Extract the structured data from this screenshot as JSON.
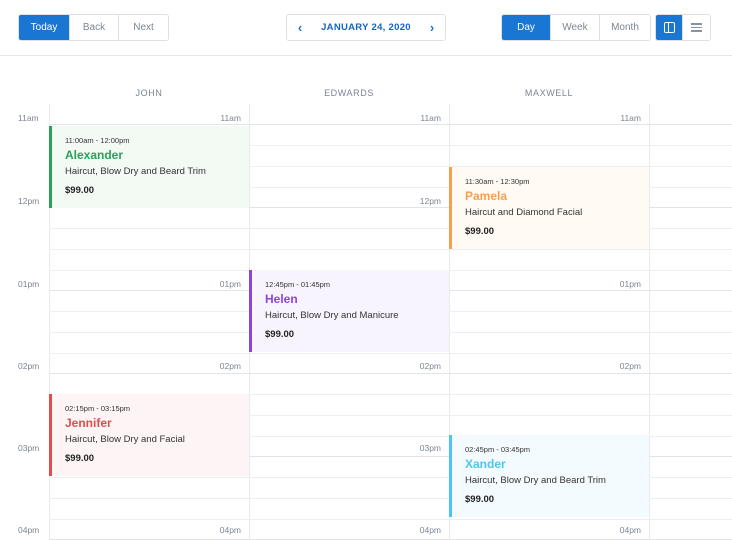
{
  "toolbar": {
    "today": "Today",
    "back": "Back",
    "next": "Next",
    "prev_arrow": "‹",
    "next_arrow": "›",
    "date": "JANUARY 24, 2020",
    "views": [
      "Day",
      "Week",
      "Month"
    ],
    "active_view": "Day",
    "accent_color": "#1976d2"
  },
  "resources": [
    "JOHN",
    "EDWARDS",
    "MAXWELL"
  ],
  "time_labels": [
    "11am",
    "12pm",
    "01pm",
    "02pm",
    "03pm",
    "04pm"
  ],
  "events": [
    {
      "time": "11:00am - 12:00pm",
      "name": "Alexander",
      "service": "Haircut, Blow Dry and Beard Trim",
      "price": "$99.00",
      "color": "#2aa15a"
    },
    {
      "time": "11:30am - 12:30pm",
      "name": "Pamela",
      "service": "Haircut and Diamond Facial",
      "price": "$99.00",
      "color": "#f3a053"
    },
    {
      "time": "12:45pm - 01:45pm",
      "name": "Helen",
      "service": "Haircut, Blow Dry and Manicure",
      "price": "$99.00",
      "color": "#8e44d8"
    },
    {
      "time": "02:15pm - 03:15pm",
      "name": "Jennifer",
      "service": "Haircut, Blow Dry and Facial",
      "price": "$99.00",
      "color": "#e24c4c"
    },
    {
      "time": "02:45pm - 03:45pm",
      "name": "Xander",
      "service": "Haircut, Blow Dry and Beard Trim",
      "price": "$99.00",
      "color": "#4cc6ee"
    }
  ]
}
